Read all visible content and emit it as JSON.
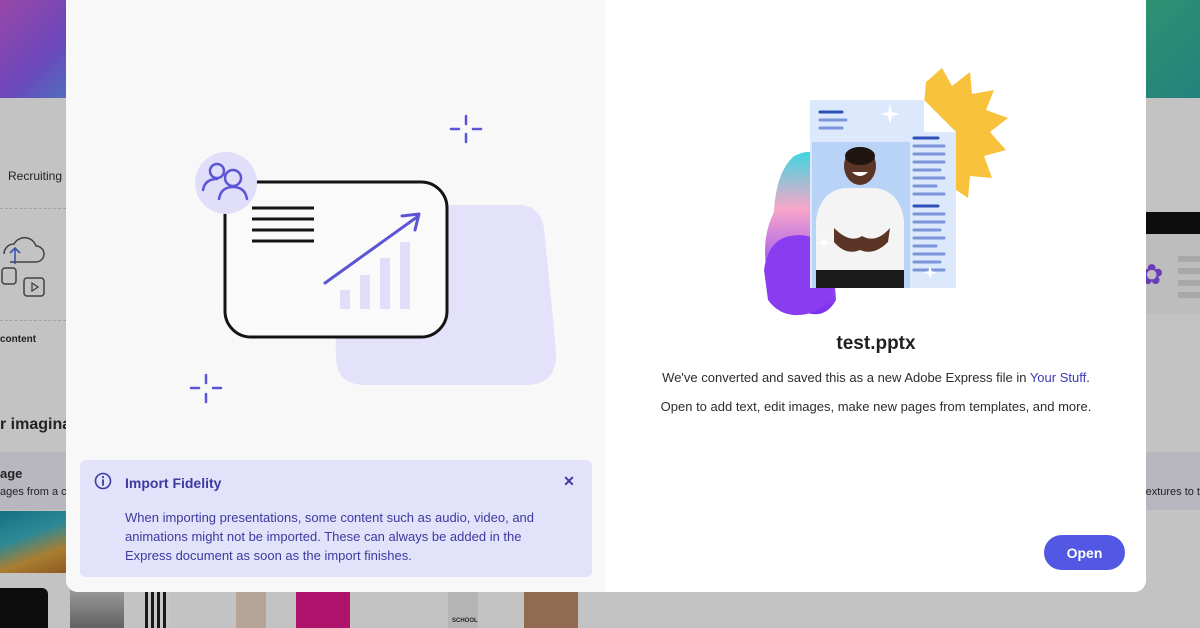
{
  "background": {
    "tab_recruiting": "Recruiting",
    "section_content": "content",
    "section_heading": "r imaginat",
    "card_title": "age",
    "card_subtitle": "ages from a c",
    "card_right_subtitle": "extures to t",
    "thumb_school_label": "SCHOOL"
  },
  "modal": {
    "info_banner": {
      "icon": "info-icon",
      "title": "Import Fidelity",
      "body": "When importing presentations, some content such as audio, video, and animations might not be imported. These can always be added in the Express document as soon as the import finishes.",
      "close_icon": "close-icon"
    },
    "file": {
      "name": "test.pptx",
      "message_prefix": "We've converted and saved this as a new Adobe Express file in ",
      "message_link": "Your Stuff",
      "message_suffix": ".",
      "message_line2": "Open to add text, edit images, make new pages from templates, and more."
    },
    "open_button": "Open"
  },
  "colors": {
    "accent": "#5258e4",
    "banner_bg": "#e3e2fb",
    "banner_text": "#3d3aa0",
    "illustration_accent": "#5b55d6",
    "sun_yellow": "#f9c23c"
  }
}
